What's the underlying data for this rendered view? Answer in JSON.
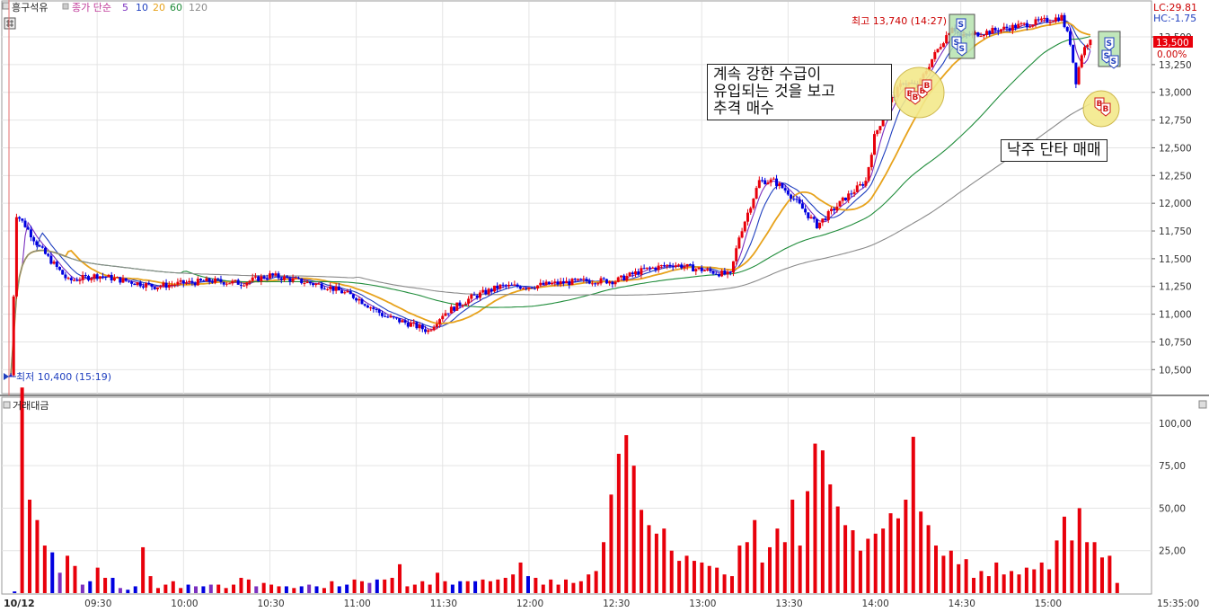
{
  "header": {
    "symbol": "흥구석유",
    "ma_label": "종가 단순",
    "ma_periods": [
      "5",
      "10",
      "20",
      "60",
      "120"
    ],
    "ma_colors": [
      "#7b2fbf",
      "#1f3fbf",
      "#e7a21b",
      "#1f8c3a",
      "#8a8a8a"
    ]
  },
  "right_info": {
    "lc": "LC:29.81",
    "hc": "HC:-1.75",
    "current": "13,500",
    "change": "0.00%"
  },
  "annotations": {
    "high": "최고 13,740 (14:27)",
    "low": "최저 10,400 (15:19)",
    "box1": "계속 강한 수급이\n유입되는 것을 보고\n추격 매수",
    "box2": "낙주 단타 매매"
  },
  "volume_panel": {
    "title": "거래대금"
  },
  "colors": {
    "up": "#e8000b",
    "down": "#0000e0",
    "grid": "#e4e4e4",
    "accent": "#cc0000"
  },
  "markers": {
    "buy": "B",
    "sell": "S"
  },
  "chart_data": [
    {
      "type": "candlestick",
      "title": "",
      "x_date_label": "10/12",
      "x_ticks": [
        "09:30",
        "10:00",
        "10:30",
        "11:00",
        "11:30",
        "12:00",
        "12:30",
        "13:00",
        "13:30",
        "14:00",
        "14:30",
        "15:00",
        "15:35:00"
      ],
      "y_ticks": [
        "10,500",
        "10,750",
        "11,000",
        "11,250",
        "11,500",
        "11,750",
        "12,000",
        "12,250",
        "12,500",
        "12,750",
        "13,000",
        "13,250",
        "13,500"
      ],
      "ylim": [
        10300,
        13800
      ],
      "high": 13740,
      "high_time": "14:27",
      "low": 10400,
      "low_time": "15:19",
      "close_path": [
        [
          "09:00",
          10450
        ],
        [
          "09:02",
          11900
        ],
        [
          "09:05",
          11800
        ],
        [
          "09:10",
          11600
        ],
        [
          "09:15",
          11450
        ],
        [
          "09:20",
          11300
        ],
        [
          "09:30",
          11350
        ],
        [
          "09:40",
          11300
        ],
        [
          "09:50",
          11250
        ],
        [
          "10:00",
          11280
        ],
        [
          "10:10",
          11300
        ],
        [
          "10:20",
          11280
        ],
        [
          "10:30",
          11350
        ],
        [
          "10:40",
          11300
        ],
        [
          "10:50",
          11250
        ],
        [
          "11:00",
          11150
        ],
        [
          "11:10",
          10980
        ],
        [
          "11:20",
          10900
        ],
        [
          "11:25",
          10850
        ],
        [
          "11:30",
          11000
        ],
        [
          "11:40",
          11150
        ],
        [
          "11:50",
          11250
        ],
        [
          "12:00",
          11250
        ],
        [
          "12:10",
          11280
        ],
        [
          "12:20",
          11300
        ],
        [
          "12:30",
          11300
        ],
        [
          "12:40",
          11400
        ],
        [
          "12:50",
          11450
        ],
        [
          "13:00",
          11400
        ],
        [
          "13:10",
          11350
        ],
        [
          "13:13",
          11700
        ],
        [
          "13:20",
          12200
        ],
        [
          "13:25",
          12200
        ],
        [
          "13:30",
          12100
        ],
        [
          "13:40",
          11800
        ],
        [
          "13:50",
          12050
        ],
        [
          "13:57",
          12200
        ],
        [
          "14:00",
          12600
        ],
        [
          "14:05",
          12900
        ],
        [
          "14:10",
          13100
        ],
        [
          "14:15",
          13050
        ],
        [
          "14:20",
          13300
        ],
        [
          "14:27",
          13600
        ],
        [
          "14:30",
          13500
        ],
        [
          "14:40",
          13550
        ],
        [
          "14:50",
          13600
        ],
        [
          "15:00",
          13650
        ],
        [
          "15:05",
          13680
        ],
        [
          "15:08",
          13450
        ],
        [
          "15:10",
          13100
        ],
        [
          "15:12",
          13350
        ],
        [
          "15:15",
          13500
        ]
      ],
      "ma_smoothing": [
        5,
        10,
        20,
        60,
        120
      ]
    },
    {
      "type": "bar",
      "title": "거래대금",
      "y_ticks": [
        "25,00",
        "50,00",
        "75,00",
        "100,00"
      ],
      "ylim": [
        0,
        110
      ],
      "values": [
        [
          2,
          1
        ],
        [
          3,
          121
        ],
        [
          3,
          55
        ],
        [
          3,
          43
        ],
        [
          3,
          28
        ],
        [
          2,
          24
        ],
        [
          1,
          12
        ],
        [
          3,
          22
        ],
        [
          3,
          16
        ],
        [
          1,
          5
        ],
        [
          2,
          7
        ],
        [
          3,
          15
        ],
        [
          3,
          9
        ],
        [
          2,
          9
        ],
        [
          1,
          3
        ],
        [
          2,
          2
        ],
        [
          2,
          4
        ],
        [
          3,
          27
        ],
        [
          3,
          10
        ],
        [
          3,
          3
        ],
        [
          3,
          5
        ],
        [
          3,
          7
        ],
        [
          3,
          3
        ],
        [
          2,
          5
        ],
        [
          1,
          4
        ],
        [
          2,
          4
        ],
        [
          1,
          5
        ],
        [
          3,
          5
        ],
        [
          3,
          3
        ],
        [
          3,
          5
        ],
        [
          3,
          9
        ],
        [
          3,
          8
        ],
        [
          1,
          4
        ],
        [
          3,
          6
        ],
        [
          3,
          5
        ],
        [
          3,
          4
        ],
        [
          2,
          4
        ],
        [
          3,
          3
        ],
        [
          2,
          4
        ],
        [
          1,
          5
        ],
        [
          2,
          4
        ],
        [
          3,
          3
        ],
        [
          3,
          7
        ],
        [
          2,
          4
        ],
        [
          2,
          5
        ],
        [
          3,
          8
        ],
        [
          3,
          7
        ],
        [
          1,
          6
        ],
        [
          2,
          8
        ],
        [
          3,
          8
        ],
        [
          3,
          9
        ],
        [
          3,
          17
        ],
        [
          3,
          4
        ],
        [
          3,
          5
        ],
        [
          3,
          7
        ],
        [
          3,
          5
        ],
        [
          3,
          12
        ],
        [
          3,
          7
        ],
        [
          2,
          5
        ],
        [
          2,
          7
        ],
        [
          3,
          7
        ],
        [
          2,
          7
        ],
        [
          3,
          8
        ],
        [
          3,
          7
        ],
        [
          3,
          8
        ],
        [
          3,
          9
        ],
        [
          3,
          11
        ],
        [
          3,
          18
        ],
        [
          2,
          10
        ],
        [
          3,
          9
        ],
        [
          3,
          5
        ],
        [
          3,
          8
        ],
        [
          3,
          5
        ],
        [
          3,
          8
        ],
        [
          3,
          6
        ],
        [
          3,
          7
        ],
        [
          3,
          11
        ],
        [
          3,
          13
        ],
        [
          3,
          30
        ],
        [
          3,
          58
        ],
        [
          3,
          82
        ],
        [
          3,
          93
        ],
        [
          3,
          75
        ],
        [
          3,
          49
        ],
        [
          3,
          40
        ],
        [
          3,
          35
        ],
        [
          3,
          38
        ],
        [
          3,
          25
        ],
        [
          3,
          19
        ],
        [
          3,
          22
        ],
        [
          3,
          19
        ],
        [
          3,
          18
        ],
        [
          3,
          16
        ],
        [
          3,
          15
        ],
        [
          3,
          11
        ],
        [
          3,
          10
        ],
        [
          3,
          28
        ],
        [
          3,
          30
        ],
        [
          3,
          43
        ],
        [
          3,
          18
        ],
        [
          3,
          27
        ],
        [
          3,
          38
        ],
        [
          3,
          30
        ],
        [
          3,
          55
        ],
        [
          3,
          28
        ],
        [
          3,
          60
        ],
        [
          3,
          88
        ],
        [
          3,
          84
        ],
        [
          3,
          64
        ],
        [
          3,
          51
        ],
        [
          3,
          40
        ],
        [
          3,
          37
        ],
        [
          3,
          25
        ],
        [
          3,
          32
        ],
        [
          3,
          35
        ],
        [
          3,
          38
        ],
        [
          3,
          47
        ],
        [
          3,
          44
        ],
        [
          3,
          55
        ],
        [
          3,
          92
        ],
        [
          3,
          48
        ],
        [
          3,
          40
        ],
        [
          3,
          28
        ],
        [
          3,
          22
        ],
        [
          3,
          25
        ],
        [
          3,
          17
        ],
        [
          3,
          20
        ],
        [
          3,
          9
        ],
        [
          3,
          13
        ],
        [
          3,
          10
        ],
        [
          3,
          18
        ],
        [
          3,
          11
        ],
        [
          3,
          13
        ],
        [
          3,
          11
        ],
        [
          3,
          15
        ],
        [
          3,
          14
        ],
        [
          3,
          18
        ],
        [
          3,
          14
        ],
        [
          3,
          31
        ],
        [
          3,
          45
        ],
        [
          3,
          31
        ],
        [
          3,
          50
        ],
        [
          3,
          30
        ],
        [
          3,
          30
        ],
        [
          3,
          21
        ],
        [
          3,
          22
        ],
        [
          3,
          6
        ]
      ]
    }
  ]
}
